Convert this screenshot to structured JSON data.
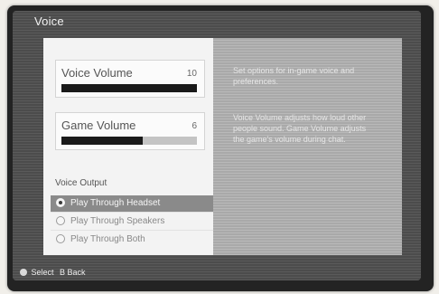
{
  "screen": {
    "title": "Voice"
  },
  "voice_volume": {
    "label": "Voice Volume",
    "value": "10",
    "level": 1.0
  },
  "game_volume": {
    "label": "Game Volume",
    "value": "6",
    "level": 0.6
  },
  "voice_output": {
    "header": "Voice Output",
    "options": [
      {
        "label": "Play Through Headset",
        "selected": true
      },
      {
        "label": "Play Through Speakers",
        "selected": false
      },
      {
        "label": "Play Through Both",
        "selected": false
      }
    ]
  },
  "help": {
    "para1": "Set options for in-game voice and preferences.",
    "para2": "Voice Volume adjusts how loud other people sound. Game Volume adjusts the game's volume during chat."
  },
  "footer": {
    "select": "Select",
    "back": "B Back"
  },
  "icons": {
    "select": "a-button-icon",
    "radio": "radio-icon"
  }
}
